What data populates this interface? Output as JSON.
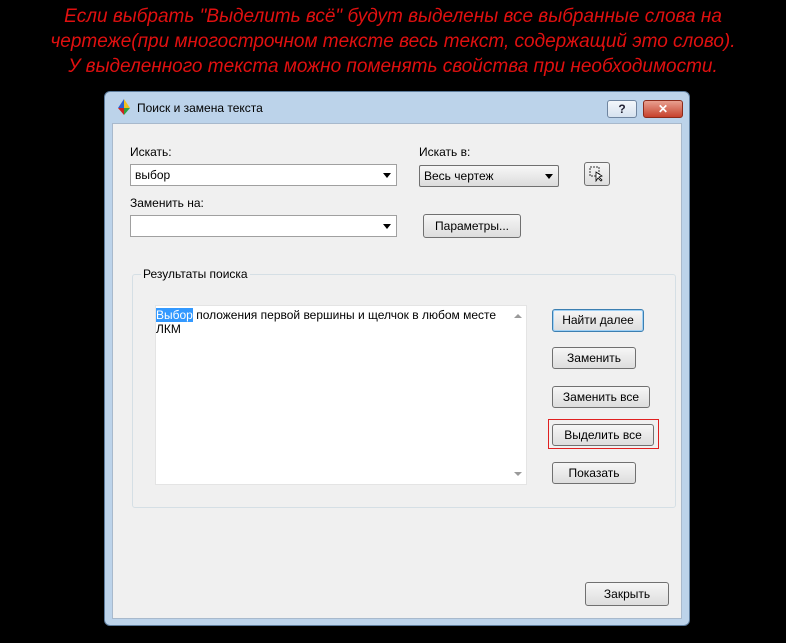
{
  "caption": {
    "line1": "Если выбрать \"Выделить всё\" будут выделены все выбранные слова на",
    "line2": "чертеже(при многострочном тексте весь текст, содержащий это слово).",
    "line3": "У выделенного текста можно поменять свойства при необходимости.",
    "color": "#e01010"
  },
  "dialog": {
    "title": "Поиск и замена текста",
    "help_label": "?",
    "close_label": "✕",
    "find_label": "Искать:",
    "find_value": "выбор",
    "search_in_label": "Искать в:",
    "search_in_value": "Весь чертеж",
    "replace_label": "Заменить на:",
    "replace_value": "",
    "params_button": "Параметры...",
    "group_title": "Результаты поиска",
    "result_highlight": "Выбор",
    "result_rest": " положения первой вершины и щелчок в любом месте ЛКМ",
    "buttons": {
      "find_next": "Найти далее",
      "replace": "Заменить",
      "replace_all": "Заменить все",
      "select_all": "Выделить все",
      "show": "Показать",
      "close": "Закрыть"
    }
  },
  "colors": {
    "highlight": "#3399ff",
    "frame_border": "#5d7c9c",
    "annotation_red": "#e02020"
  }
}
